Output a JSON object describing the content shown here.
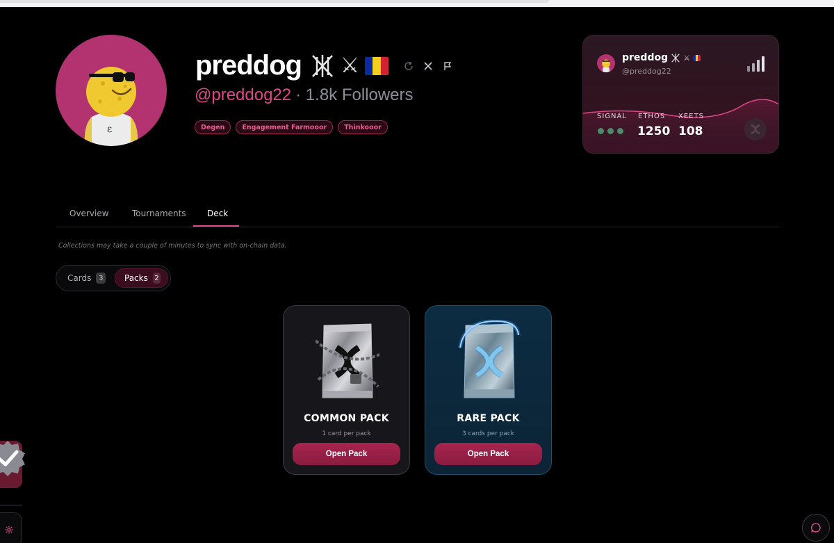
{
  "profile": {
    "display_name": "preddog",
    "name_glyph_1": "⚔",
    "handle": "@preddog22",
    "followers": "· 1.8k Followers",
    "tags": [
      "Degen",
      "Engagement Farmooor",
      "Thinkooor"
    ]
  },
  "profile_card": {
    "name": "preddog",
    "name_glyph": "⚔",
    "handle": "@preddog22",
    "stats": {
      "signal_label": "SIGNAL",
      "ethos_label": "ETHOS",
      "ethos_value": "1250",
      "xeets_label": "XEETS",
      "xeets_value": "108"
    }
  },
  "tabs": {
    "overview": "Overview",
    "tournaments": "Tournaments",
    "deck": "Deck"
  },
  "sync_note": "Collections may take a couple of minutes to sync with on-chain data.",
  "segmented": {
    "cards_label": "Cards",
    "cards_count": "3",
    "packs_label": "Packs",
    "packs_count": "2"
  },
  "packs": [
    {
      "title": "COMMON PACK",
      "subtitle": "1 card per pack",
      "button": "Open Pack"
    },
    {
      "title": "RARE PACK",
      "subtitle": "3 cards per pack",
      "button": "Open Pack"
    }
  ],
  "colors": {
    "accent": "#e0468a",
    "button": "#9a2048",
    "avatar_bg": "#b2336f",
    "rare_bg": "#0c2c42"
  },
  "icons": [
    "refresh-icon",
    "x-logo-icon",
    "flag-icon",
    "signal-bars-icon",
    "verified-badge-icon",
    "settings-icon",
    "chat-icon",
    "pack-logo-icon"
  ]
}
